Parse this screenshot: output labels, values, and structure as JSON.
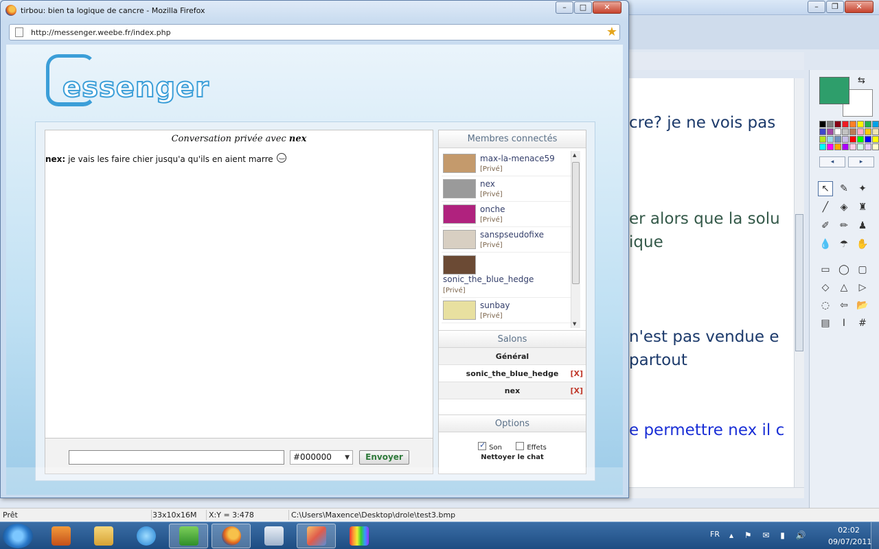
{
  "firefox": {
    "title": "tirbou: bien ta logique de cancre - Mozilla Firefox",
    "url": "http://messenger.weebe.fr/index.php",
    "window_buttons": [
      "–",
      "□",
      "✕"
    ]
  },
  "messenger": {
    "logo_text": "essenger",
    "conversation": {
      "header_prefix": "Conversation privée avec",
      "header_user": "nex",
      "messages": [
        {
          "author": "nex",
          "text": "je vais les faire chier jusqu'a qu'ils en aient marre"
        }
      ]
    },
    "input": {
      "value": "",
      "color_value": "#000000",
      "send_label": "Envoyer"
    },
    "members": {
      "title": "Membres connectés",
      "items": [
        {
          "name": "max-la-menace59",
          "tag": "[Privé]",
          "avatar_color": "#c49a6c"
        },
        {
          "name": "nex",
          "tag": "[Privé]",
          "avatar_color": "#9a9a9a"
        },
        {
          "name": "onche",
          "tag": "[Privé]",
          "avatar_color": "#b0227e"
        },
        {
          "name": "sanspseudofixe",
          "tag": "[Privé]",
          "avatar_color": "#d8cfc2"
        },
        {
          "name": "sonic_the_blue_hedge",
          "tag": "[Privé]",
          "avatar_color": "#6b4a34"
        },
        {
          "name": "sunbay",
          "tag": "[Privé]",
          "avatar_color": "#e8e0a0"
        }
      ]
    },
    "salons": {
      "title": "Salons",
      "items": [
        {
          "name": "Général",
          "close": ""
        },
        {
          "name": "sonic_the_blue_hedge",
          "close": "[X]"
        },
        {
          "name": "nex",
          "close": "[X]"
        }
      ]
    },
    "options": {
      "title": "Options",
      "son_label": "Son",
      "son_checked": true,
      "effets_label": "Effets",
      "effets_checked": false,
      "clear_label": "Nettoyer le chat"
    }
  },
  "paint": {
    "canvas_lines": [
      {
        "text": "cre? je ne vois pas",
        "style": "default"
      },
      {
        "text": "er alors que la solu",
        "style": "olive"
      },
      {
        "text": "ique",
        "style": "default"
      },
      {
        "text": "n'est pas vendue e",
        "style": "default"
      },
      {
        "text": "partout",
        "style": "default"
      },
      {
        "text": "e permettre nex il c",
        "style": "blue"
      }
    ],
    "primary_color": "#2e9e6b",
    "secondary_color": "#ffffff",
    "status": {
      "ready": "Prêt",
      "size": "33x10x16M",
      "coords": "X:Y = 3:478",
      "path": "C:\\Users\\Maxence\\Desktop\\drole\\test3.bmp"
    }
  },
  "taskbar": {
    "lang": "FR",
    "time": "02:02",
    "date": "09/07/2011"
  }
}
